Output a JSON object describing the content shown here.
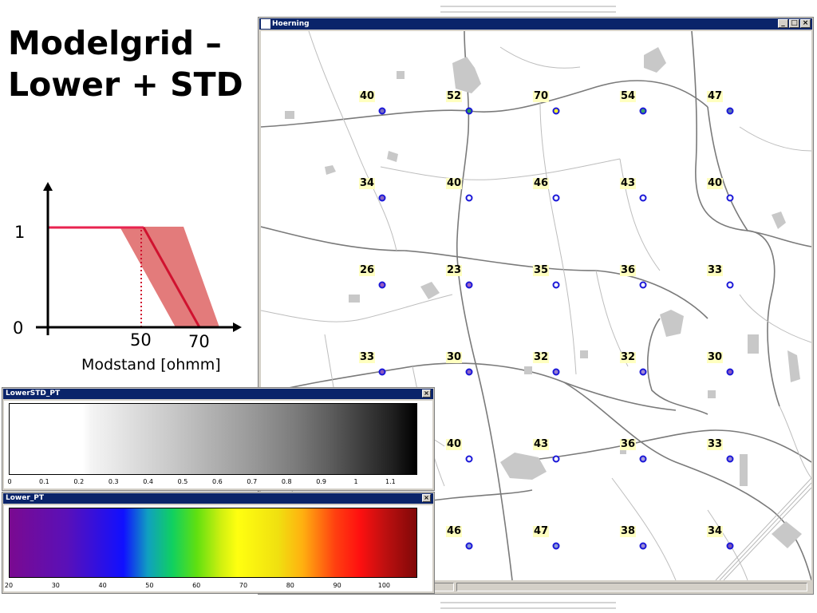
{
  "slide": {
    "title_line1": "Modelgrid –",
    "title_line2": "Lower + STD"
  },
  "diagram": {
    "y_label_top": "1",
    "y_label_bottom": "0",
    "x_tick_50": "50",
    "x_tick_70": "70",
    "x_label": "Modstand [ohmm]"
  },
  "map_window": {
    "title": "Hoerning",
    "buttons": [
      "_",
      "□",
      "×"
    ],
    "points": [
      {
        "label": "40",
        "color": "#7a6fc0"
      },
      {
        "label": "52",
        "color": "#2e9b5a"
      },
      {
        "label": "70",
        "color": "#f6f62a"
      },
      {
        "label": "54",
        "color": "#3fa46b"
      },
      {
        "label": "47",
        "color": "#5a76b0"
      },
      {
        "label": "34",
        "color": "#8c68c0"
      },
      {
        "label": "40",
        "color": "#ffffff"
      },
      {
        "label": "46",
        "color": "#ffffff"
      },
      {
        "label": "43",
        "color": "#ffffff"
      },
      {
        "label": "40",
        "color": "#ffffff"
      },
      {
        "label": "26",
        "color": "#9b5bc0"
      },
      {
        "label": "23",
        "color": "#a066c4"
      },
      {
        "label": "35",
        "color": "#ffffff"
      },
      {
        "label": "36",
        "color": "#ffffff"
      },
      {
        "label": "33",
        "color": "#ffffff"
      },
      {
        "label": "33",
        "color": "#8a5ac0"
      },
      {
        "label": "30",
        "color": "#8f65c4"
      },
      {
        "label": "32",
        "color": "#9a7fcf"
      },
      {
        "label": "32",
        "color": "#a38ad3"
      },
      {
        "label": "30",
        "color": "#8a5ac0"
      },
      {
        "label": "40",
        "color": "#ffffff"
      },
      {
        "label": "43",
        "color": "#ffffff"
      },
      {
        "label": "36",
        "color": "#a9a0d8"
      },
      {
        "label": "33",
        "color": "#9b8ad0"
      },
      {
        "label": "46",
        "color": "#8898d8"
      },
      {
        "label": "47",
        "color": "#8e9cd6"
      },
      {
        "label": "38",
        "color": "#9c8ed2"
      },
      {
        "label": "34",
        "color": "#7a55b8"
      }
    ]
  },
  "legend_std": {
    "title": "LowerSTD_PT",
    "ticks": [
      "0",
      "0.1",
      "0.2",
      "0.3",
      "0.4",
      "0.5",
      "0.6",
      "0.7",
      "0.8",
      "0.9",
      "1",
      "1.1"
    ],
    "close": "×"
  },
  "legend_lower": {
    "title": "Lower_PT",
    "ticks": [
      "20",
      "30",
      "40",
      "50",
      "60",
      "70",
      "80",
      "90",
      "100"
    ],
    "close": "×"
  }
}
